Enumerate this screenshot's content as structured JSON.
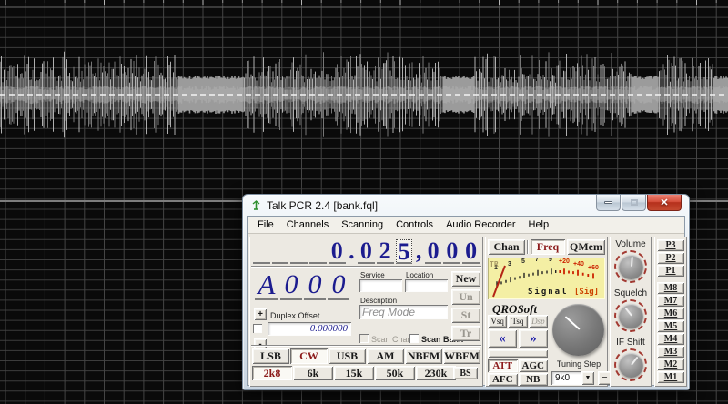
{
  "window": {
    "title": "Talk PCR 2.4 [bank.fql]"
  },
  "menu": [
    "File",
    "Channels",
    "Scanning",
    "Controls",
    "Audio Recorder",
    "Help"
  ],
  "freq": {
    "digits": [
      "",
      "",
      "",
      "",
      "0",
      ".",
      "0",
      "2",
      "5",
      ",",
      "0",
      "0",
      "0"
    ],
    "selected_index": 8
  },
  "channel": {
    "bank_letter": "A",
    "number_digits": [
      "0",
      "0",
      "0"
    ],
    "plus": "+",
    "minus": "-",
    "duplex_label": "Duplex Offset",
    "duplex_value": "0.000000",
    "service_label": "Service",
    "service_value": "",
    "location_label": "Location",
    "location_value": "",
    "description_label": "Description",
    "description_value": "Freq Mode",
    "scan_chan_label": "Scan Chan",
    "scan_bank_label": "Scan Bank",
    "new_label": "New",
    "un_label": "Un",
    "st_label": "St",
    "tr_label": "Tr"
  },
  "modes": {
    "items": [
      "LSB",
      "CW",
      "USB",
      "AM",
      "NBFM",
      "WBFM"
    ],
    "active": "CW"
  },
  "filters": {
    "items": [
      "2k8",
      "6k",
      "15k",
      "50k",
      "230k"
    ],
    "active": "2k8",
    "bs": "BS"
  },
  "display_tabs": {
    "items": [
      "Chan",
      "Freq",
      "QMem"
    ],
    "active": "Freq"
  },
  "meter": {
    "tr": "TR",
    "ticks": [
      "1",
      "3",
      "5",
      "7",
      "9",
      "+20",
      "+40",
      "+60"
    ],
    "label": "Signal",
    "sig": "[Sig]"
  },
  "brand": "QROSoft",
  "dsp_buttons": {
    "items": [
      "Vsq",
      "Tsq",
      "Dsp"
    ],
    "disabled": "Dsp"
  },
  "arrows": {
    "left": "«",
    "right": "»"
  },
  "toggles": {
    "items": [
      "ATT",
      "AGC",
      "AFC",
      "NB"
    ],
    "active": "ATT"
  },
  "tuning": {
    "label": "Tuning Step",
    "step": "9k0",
    "equals": "="
  },
  "knobs": [
    {
      "label": "Volume"
    },
    {
      "label": "Squelch"
    },
    {
      "label": "IF Shift"
    }
  ],
  "p_buttons": [
    "P3",
    "P2",
    "P1"
  ],
  "m_buttons": [
    "M8",
    "M7",
    "M6",
    "M5",
    "M4",
    "M3",
    "M2",
    "M1"
  ],
  "colors": {
    "accent_maroon": "#8b1a1a",
    "digit_navy": "#1c1c8f",
    "meter_bg": "#f4efa4",
    "meter_red": "#cc2200"
  }
}
